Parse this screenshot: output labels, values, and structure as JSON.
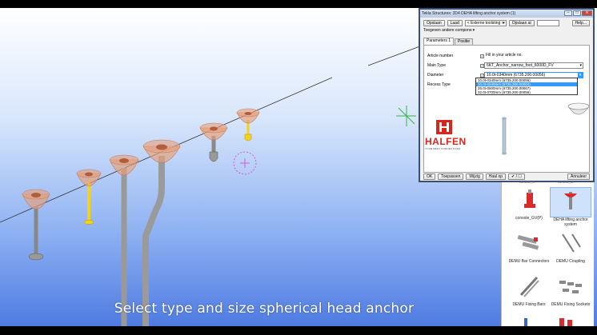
{
  "dialog": {
    "title": "Tekla Structures: 3D4 DEHA lifting anchor system (1)",
    "toolbar": {
      "save": "Opslaan",
      "load": "Laad",
      "attribute_file": "< Externe toolsting >",
      "save_as": "Opslaan al",
      "help": "Help..."
    },
    "show_other_components": "Toegeven andere compone",
    "tabs": [
      "Parameters 1",
      "Positie"
    ],
    "params": {
      "article_number_label": "Article number",
      "article_number_value": "Fill in your article no.",
      "main_type_label": "Main Type",
      "main_type_value": "6KT_Anchor_narrow_foot_6000D_FV",
      "diameter_label": "Diameter",
      "diameter_value": "10.0t-0340mm (6735.200.00056)",
      "recess_type_label": "Recess Type"
    },
    "diameter_options": [
      "10.0t-0340mm (6735.200.00056)",
      "10.0t-0240mm (6735.200.00064)",
      "26.0t-0500mm (6735.200.00067)",
      "32.0t-0700mm (6735.200.00056)"
    ],
    "diameter_selected_index": 1,
    "brand": {
      "name": "HALFEN",
      "tagline": "YOUR BEST CONNECTIONS",
      "color": "#d7261e"
    },
    "bottom_buttons": {
      "ok": "OK",
      "apply": "Toepassen",
      "modify": "Wijzig",
      "get": "Haal op",
      "toggle": "✔ / ☐",
      "cancel": "Annuleer"
    }
  },
  "catalog": {
    "header_left": "console_G",
    "header_right": "console_on",
    "items": [
      {
        "label": "console_GV(P)",
        "icon": "red-console-icon"
      },
      {
        "label": "DEHA lifting anchor system",
        "icon": "lifting-anchor-icon",
        "selected": true
      },
      {
        "label": "DEMU Bar Connectors",
        "icon": "bar-connector-icon"
      },
      {
        "label": "DEMU Coupling",
        "icon": "coupling-icon"
      },
      {
        "label": "DEMU Fixing Bars",
        "icon": "fixing-bars-icon"
      },
      {
        "label": "DEMU Fixing Sockets",
        "icon": "fixing-sockets-icon"
      }
    ]
  },
  "caption": "Select type and size spherical head anchor",
  "colors": {
    "accent": "#3399ff",
    "anchor_highlight": "#f2d21b",
    "recess_cap": "#e8a07a"
  }
}
